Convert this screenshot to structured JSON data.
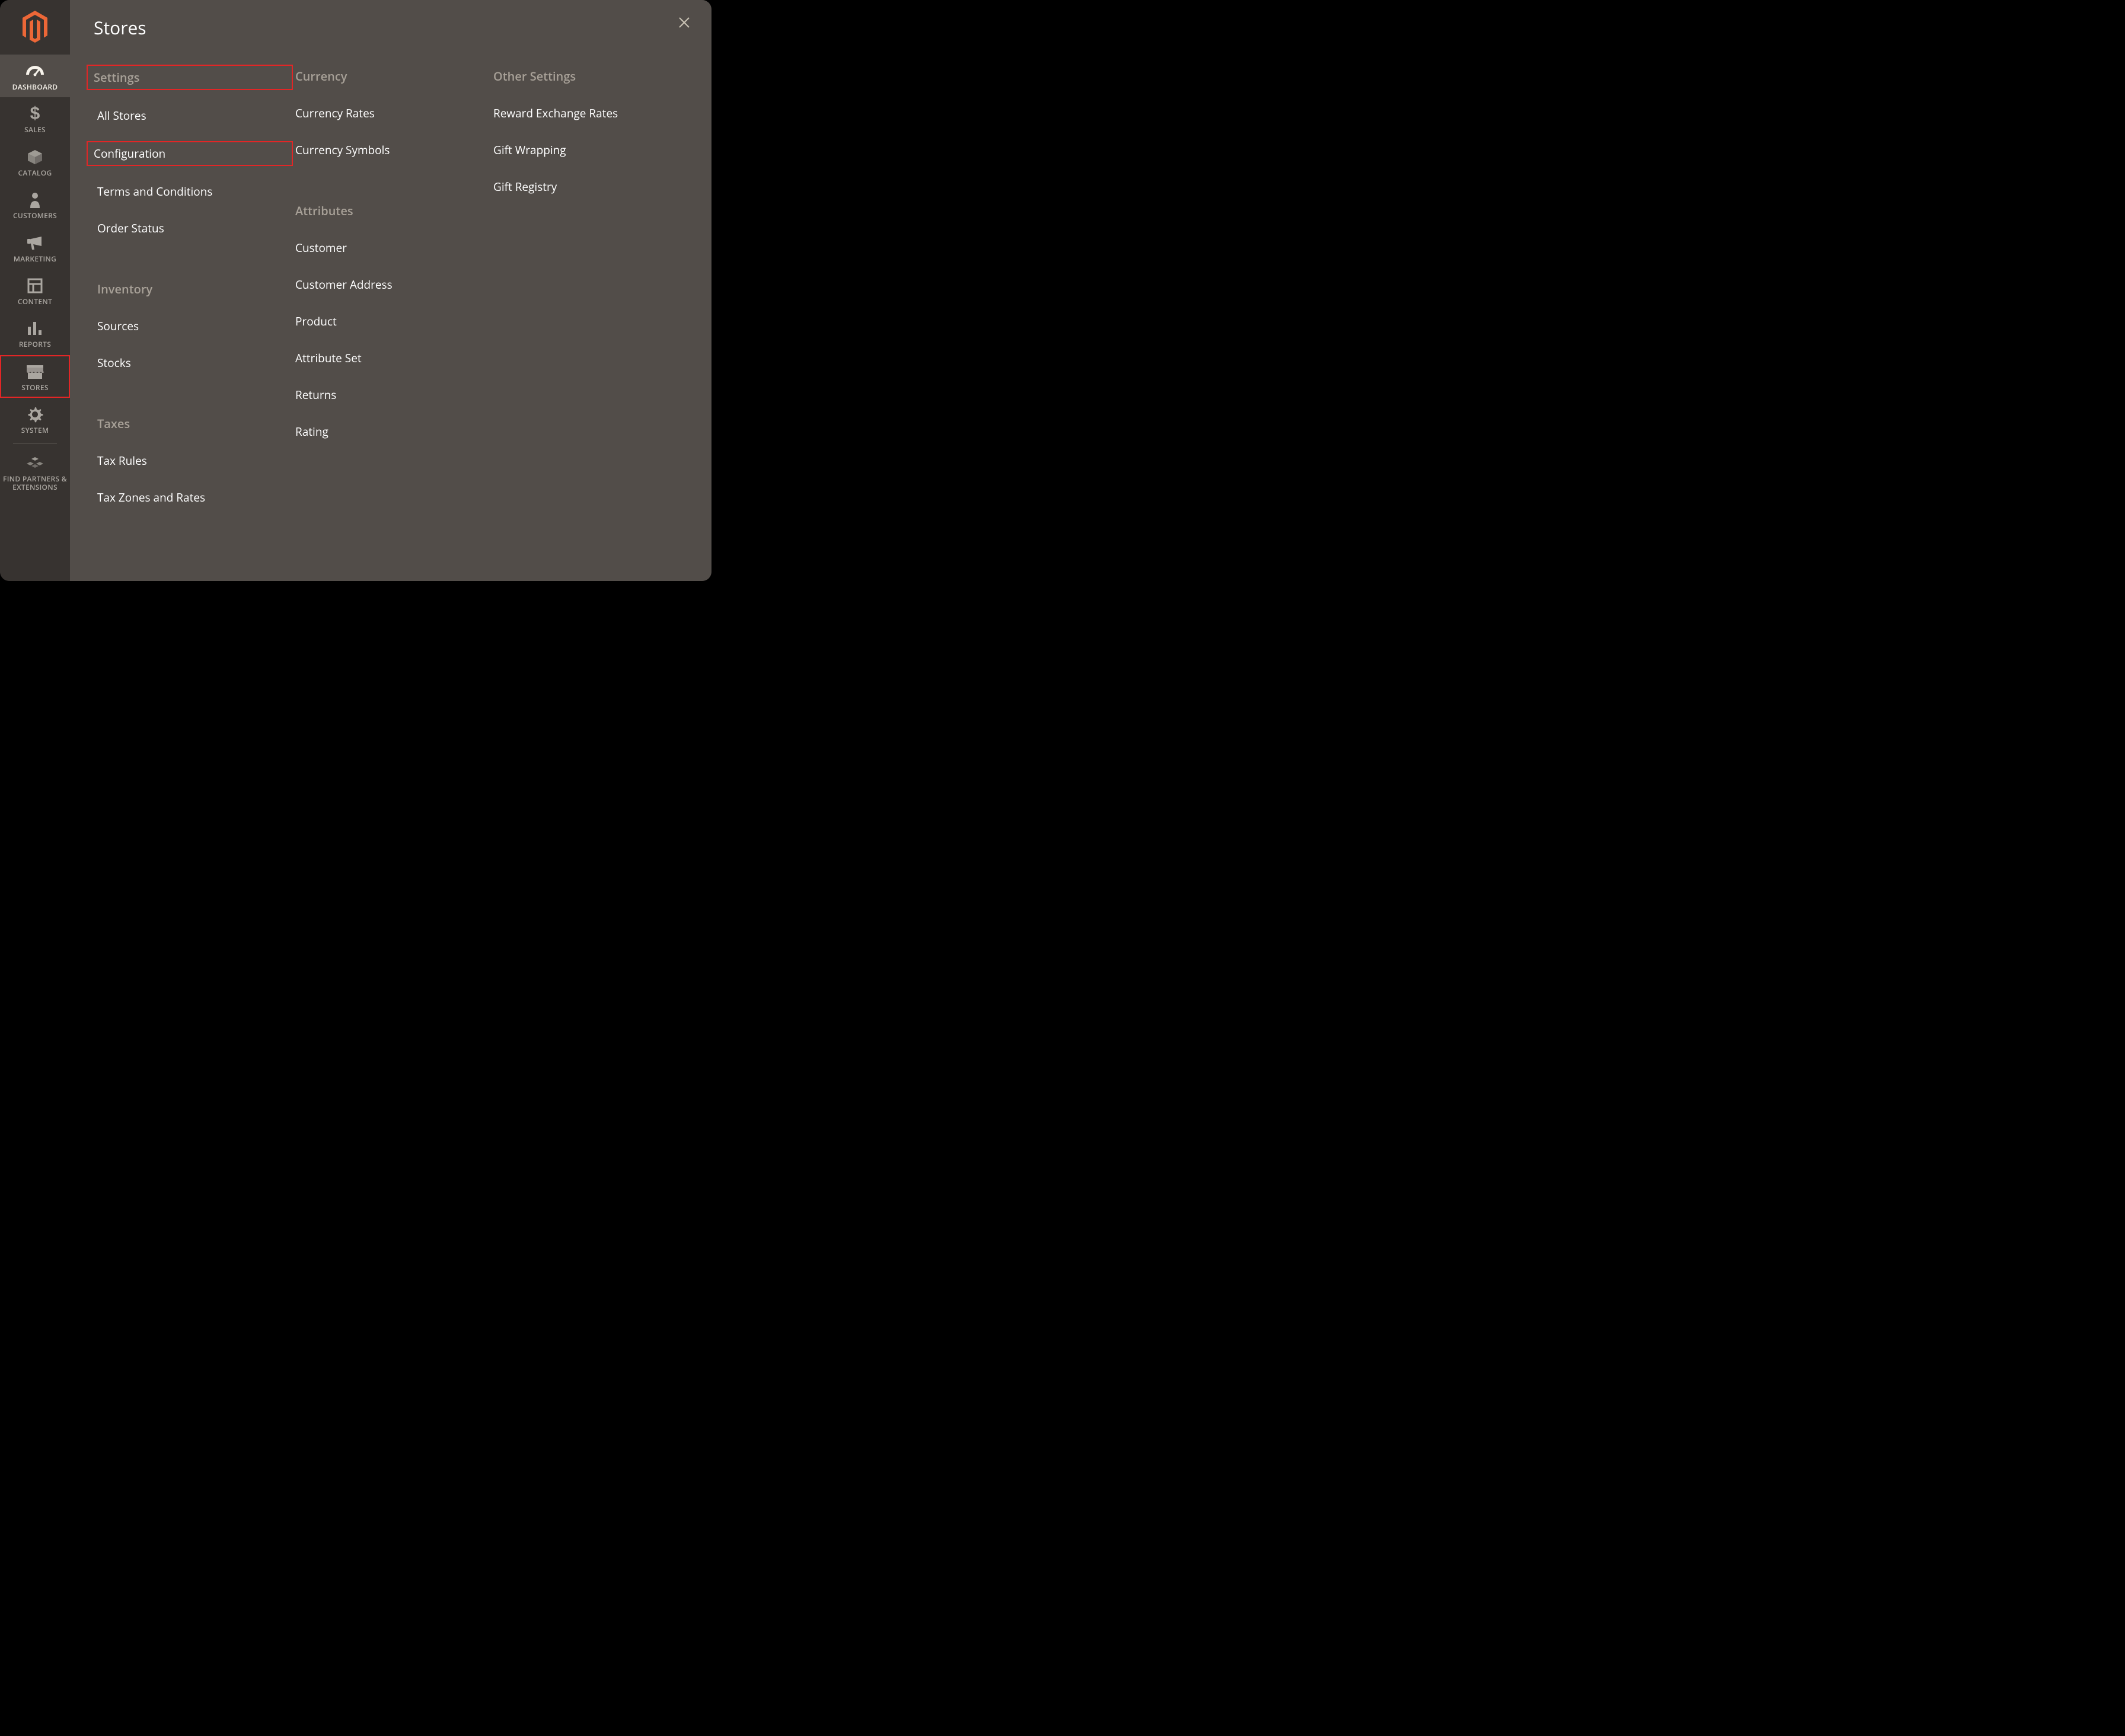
{
  "panel_title": "Stores",
  "sidebar": {
    "items": [
      {
        "id": "dashboard",
        "label": "DASHBOARD",
        "active": true
      },
      {
        "id": "sales",
        "label": "SALES"
      },
      {
        "id": "catalog",
        "label": "CATALOG"
      },
      {
        "id": "customers",
        "label": "CUSTOMERS"
      },
      {
        "id": "marketing",
        "label": "MARKETING"
      },
      {
        "id": "content",
        "label": "CONTENT"
      },
      {
        "id": "reports",
        "label": "REPORTS"
      },
      {
        "id": "stores",
        "label": "STORES",
        "highlight": true
      },
      {
        "id": "system",
        "label": "SYSTEM"
      },
      {
        "id": "find-partners",
        "label": "FIND PARTNERS & EXTENSIONS"
      }
    ]
  },
  "columns": [
    {
      "sections": [
        {
          "heading": "Settings",
          "heading_boxed": true,
          "links": [
            {
              "text": "All Stores"
            },
            {
              "text": "Configuration",
              "boxed": true
            },
            {
              "text": "Terms and Conditions"
            },
            {
              "text": "Order Status"
            }
          ]
        },
        {
          "heading": "Inventory",
          "links": [
            {
              "text": "Sources"
            },
            {
              "text": "Stocks"
            }
          ]
        },
        {
          "heading": "Taxes",
          "links": [
            {
              "text": "Tax Rules"
            },
            {
              "text": "Tax Zones and Rates"
            }
          ]
        }
      ]
    },
    {
      "sections": [
        {
          "heading": "Currency",
          "links": [
            {
              "text": "Currency Rates"
            },
            {
              "text": "Currency Symbols"
            }
          ]
        },
        {
          "heading": "Attributes",
          "links": [
            {
              "text": "Customer"
            },
            {
              "text": "Customer Address"
            },
            {
              "text": "Product"
            },
            {
              "text": "Attribute Set"
            },
            {
              "text": "Returns"
            },
            {
              "text": "Rating"
            }
          ]
        }
      ]
    },
    {
      "sections": [
        {
          "heading": "Other Settings",
          "links": [
            {
              "text": "Reward Exchange Rates"
            },
            {
              "text": "Gift Wrapping"
            },
            {
              "text": "Gift Registry"
            }
          ]
        }
      ]
    }
  ]
}
